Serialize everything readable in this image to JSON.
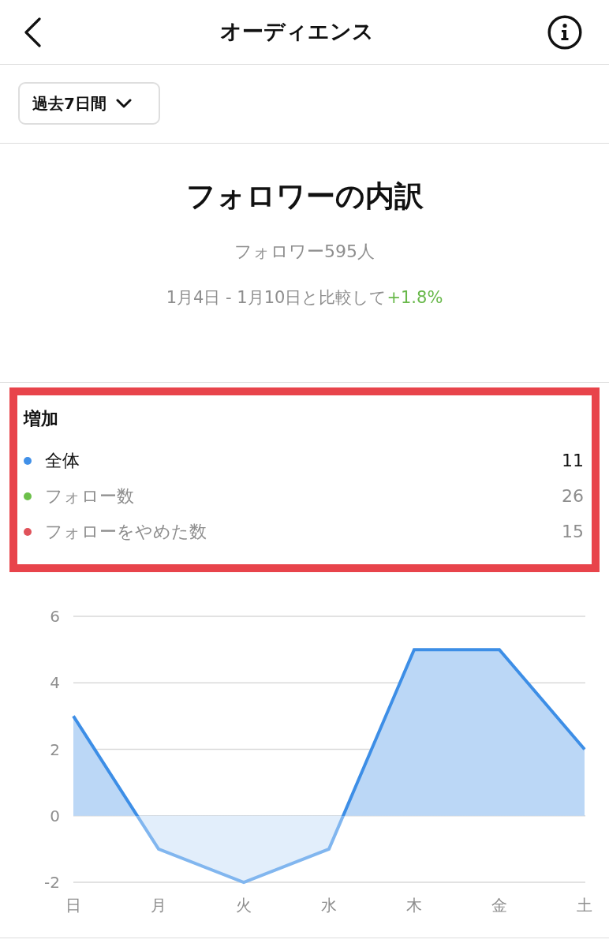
{
  "header": {
    "title": "オーディエンス"
  },
  "period_filter": {
    "label": "過去7日間"
  },
  "summary": {
    "title": "フォロワーの内訳",
    "followers": "フォロワー595人",
    "comparison": "1月4日 - 1月10日と比較して",
    "change": "+1.8%"
  },
  "growth": {
    "title": "増加",
    "highlighted": true,
    "items": [
      {
        "label": "全体",
        "value": "11",
        "color": "#4190e8",
        "selected": true
      },
      {
        "label": "フォロー数",
        "value": "26",
        "color": "#6cc04a",
        "selected": false
      },
      {
        "label": "フォローをやめた数",
        "value": "15",
        "color": "#e0525a",
        "selected": false
      }
    ]
  },
  "chart": {
    "chart_data": {
      "type": "area",
      "grid": true,
      "categories": [
        "日",
        "月",
        "火",
        "水",
        "木",
        "金",
        "土"
      ],
      "series": [
        {
          "color": "#3d8ee6",
          "values": [
            3,
            -1,
            -2,
            -1,
            5,
            5,
            2
          ]
        }
      ],
      "ylim": [
        -2,
        6
      ],
      "yticks": [
        -2,
        0,
        2,
        4,
        6
      ]
    }
  }
}
